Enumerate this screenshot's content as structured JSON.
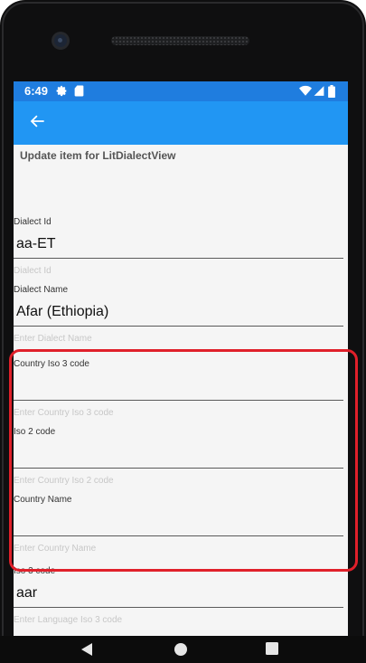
{
  "status_bar": {
    "time": "6:49"
  },
  "header": {
    "title": "Update item for LitDialectView"
  },
  "fields": [
    {
      "label": "Dialect Id",
      "value": "aa-ET",
      "placeholder": "Dialect Id"
    },
    {
      "label": "Dialect Name",
      "value": "Afar (Ethiopia)",
      "placeholder": "Enter Dialect Name"
    },
    {
      "label": "Country Iso 3 code",
      "value": "",
      "placeholder": "Enter Country Iso 3 code"
    },
    {
      "label": "Iso 2 code",
      "value": "",
      "placeholder": "Enter Country Iso 2 code"
    },
    {
      "label": "Country Name",
      "value": "",
      "placeholder": "Enter Country Name"
    },
    {
      "label": "Iso 3 code",
      "value": "aar",
      "placeholder": "Enter Language Iso 3 code"
    }
  ],
  "colors": {
    "toolbar": "#2196f3",
    "status_bar": "#1f7ddf",
    "highlight": "#e0202a"
  },
  "icons": {
    "back": "arrow-left-icon",
    "status_left": [
      "gear-icon",
      "sd-card-icon"
    ],
    "status_right": [
      "wifi-icon",
      "cell-signal-icon",
      "battery-icon"
    ],
    "nav": [
      "back-triangle-icon",
      "home-circle-icon",
      "recents-square-icon"
    ]
  }
}
